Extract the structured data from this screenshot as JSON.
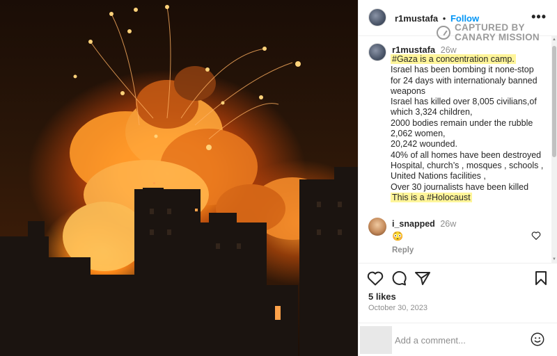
{
  "post": {
    "image_alt": "Explosion over city at night",
    "author": "r1mustafa",
    "separator": "•",
    "follow_label": "Follow",
    "more_icon": "more-horizontal-icon",
    "watermark_line1": "CAPTURED BY",
    "watermark_line2": "CANARY MISSION"
  },
  "caption": {
    "author": "r1mustafa",
    "time": "26w",
    "lines": [
      "#Gaza is a concentration camp.",
      "Israel has been bombing it none-stop",
      "for 24 days with internationaly banned",
      "weapons",
      "Israel has killed over 8,005 civilians,of",
      "which 3,324 children,",
      "2000 bodies remain under the rubble",
      "2,062 women,",
      "20,242 wounded.",
      "40% of all homes have been destroyed",
      "Hospital, church’s , mosques , schools ,",
      "United Nations facilities ,",
      "Over 30 journalists have been killed",
      "This is a #Holocaust"
    ]
  },
  "comment": {
    "author": "i_snapped",
    "time": "26w",
    "text": "😳",
    "reply_label": "Reply"
  },
  "actions": {
    "likes": "5 likes",
    "date": "October 30, 2023"
  },
  "comment_box": {
    "placeholder": "Add a comment..."
  },
  "colors": {
    "accent": "#0095f6",
    "highlight": "#fff59a",
    "muted": "#8e8e8e"
  }
}
